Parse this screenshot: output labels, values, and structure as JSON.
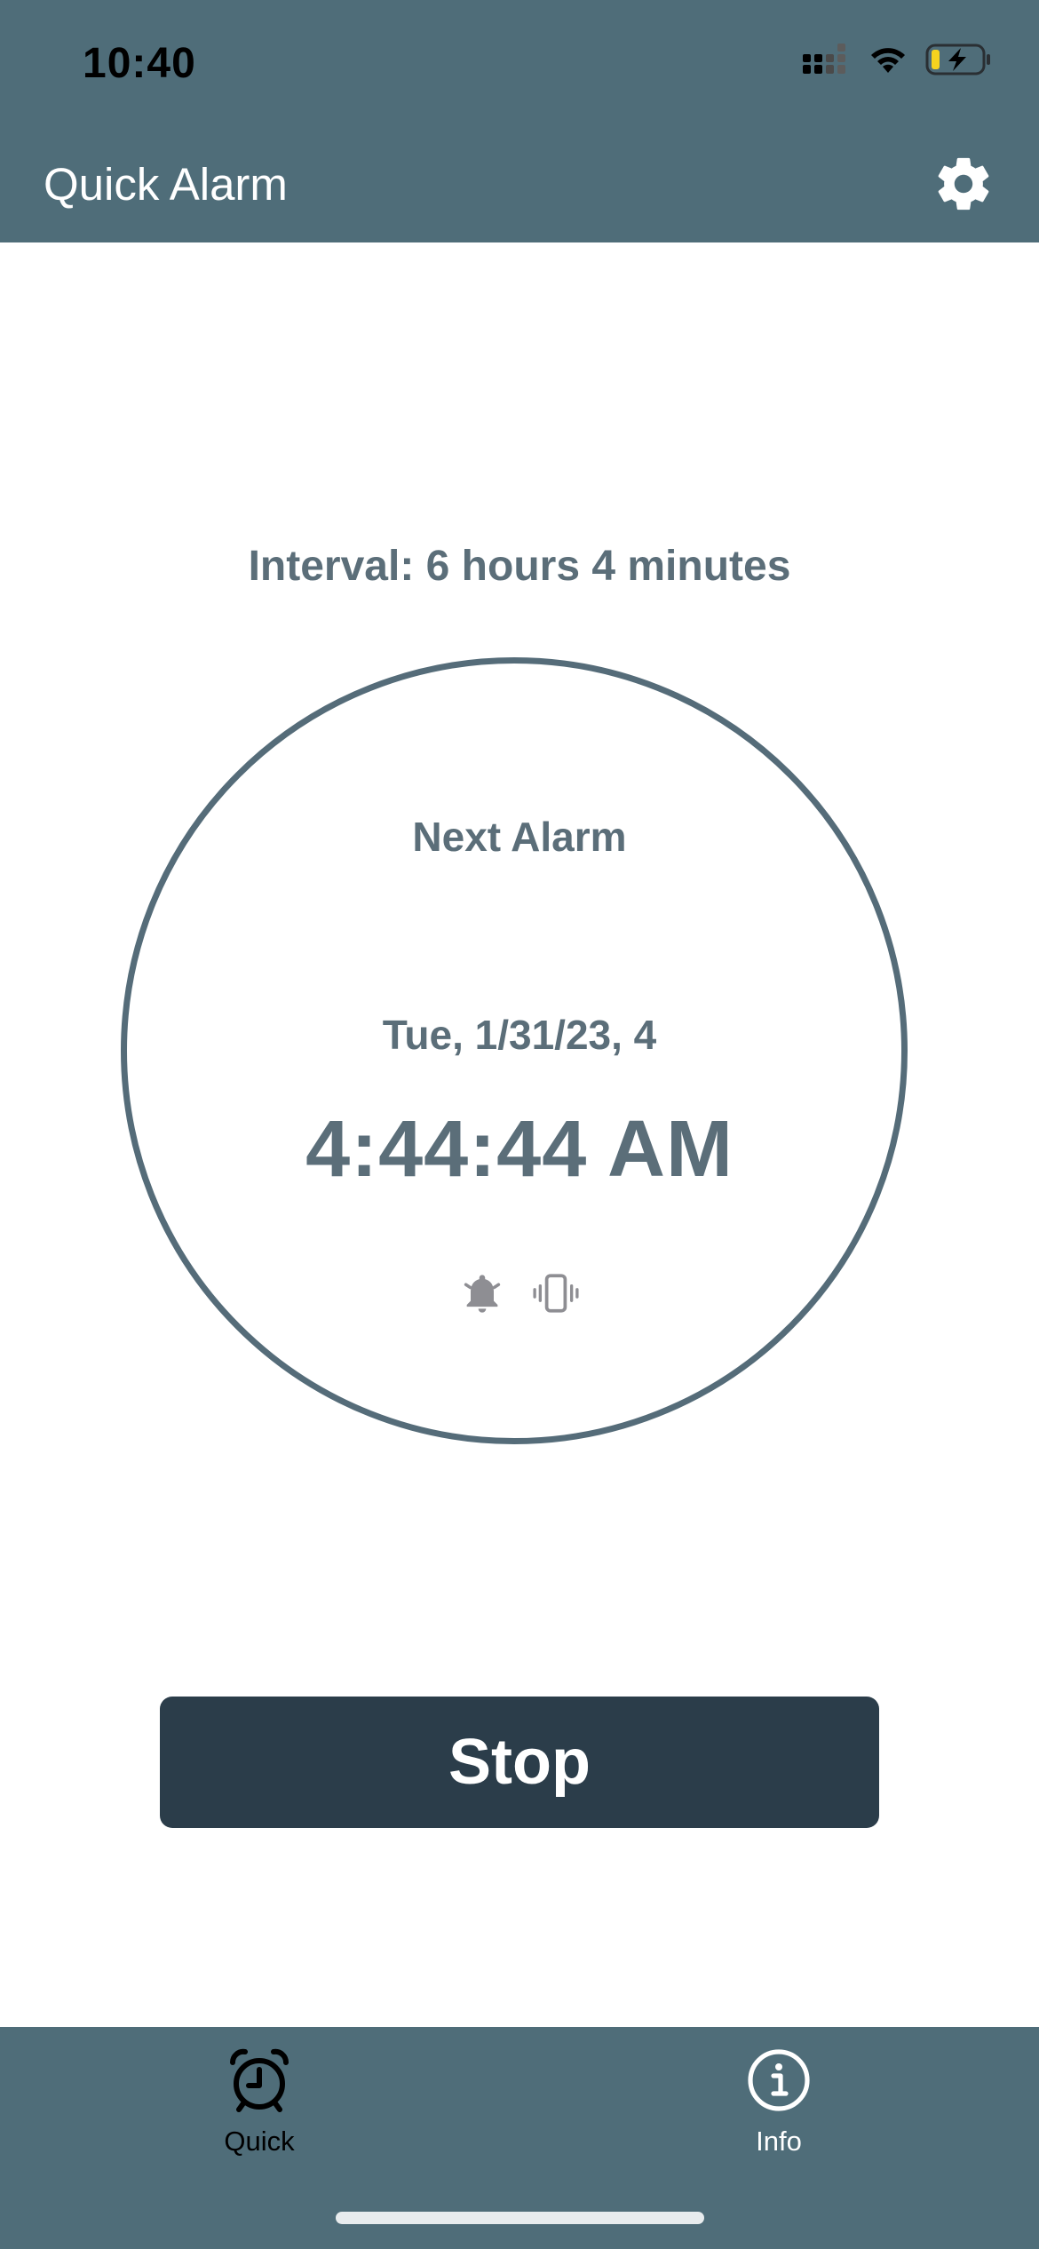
{
  "status_bar": {
    "time": "10:40",
    "icons": [
      "cellular-signal-icon",
      "wifi-icon",
      "battery-charging-icon"
    ]
  },
  "header": {
    "title": "Quick Alarm",
    "settings_icon": "gear-icon"
  },
  "main": {
    "interval_text": "Interval: 6 hours 4 minutes",
    "next_alarm_label": "Next Alarm",
    "next_alarm_date": "Tue, 1/31/23, 4",
    "next_alarm_time": "4:44:44 AM",
    "alert_icons": [
      "bell-icon",
      "vibrate-icon"
    ],
    "stop_label": "Stop"
  },
  "tabbar": {
    "tabs": [
      {
        "label": "Quick",
        "icon": "alarm-clock-icon",
        "active": true
      },
      {
        "label": "Info",
        "icon": "info-circle-icon",
        "active": false
      }
    ]
  },
  "colors": {
    "bar_background": "#4f6d79",
    "text_primary": "#5b6e79",
    "circle_stroke": "#556c79",
    "stop_button": "#2b3d4a",
    "icon_gray": "#8e8e93"
  }
}
